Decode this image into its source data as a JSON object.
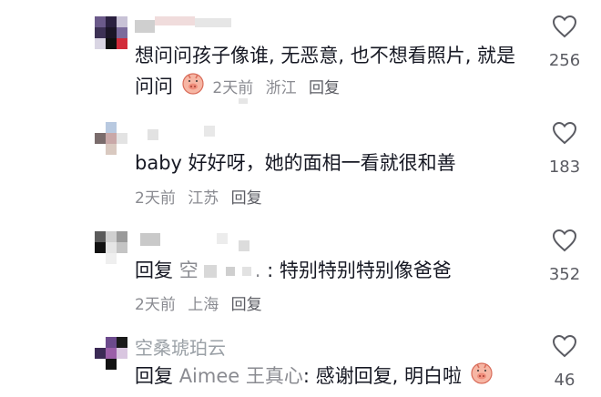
{
  "comments": [
    {
      "username": "",
      "body": "想问问孩子像谁, 无恶意, 也不想看照片, 就是问问",
      "body_line1": "想问问孩子像谁, 无恶意, 也不想看照片, 就是",
      "body_line2": "问问",
      "time": "2天前",
      "location": "浙江",
      "reply_label": "回复",
      "likes": "256",
      "emoji": "pig-face-emoji"
    },
    {
      "username": "",
      "body": "baby 好好呀，她的面相一看就很和善",
      "time": "2天前",
      "location": "江苏",
      "reply_label": "回复",
      "likes": "183"
    },
    {
      "username": "",
      "reply_prefix": "回复",
      "reply_target": "空",
      "reply_target_tail": ".",
      "body": ": 特别特别特别像爸爸",
      "time": "2天前",
      "location": "上海",
      "reply_label": "回复",
      "likes": "352"
    },
    {
      "username": "空桑琥珀云",
      "reply_prefix": "回复",
      "reply_target": "Aimee 王真心",
      "body": ": 感谢回复, 明白啦",
      "likes": "46",
      "emoji": "pig-face-emoji"
    }
  ],
  "icons": {
    "like": "heart-outline-icon"
  },
  "colors": {
    "text": "#161823",
    "meta": "#8a8b91",
    "muted": "#9aa0a6"
  }
}
